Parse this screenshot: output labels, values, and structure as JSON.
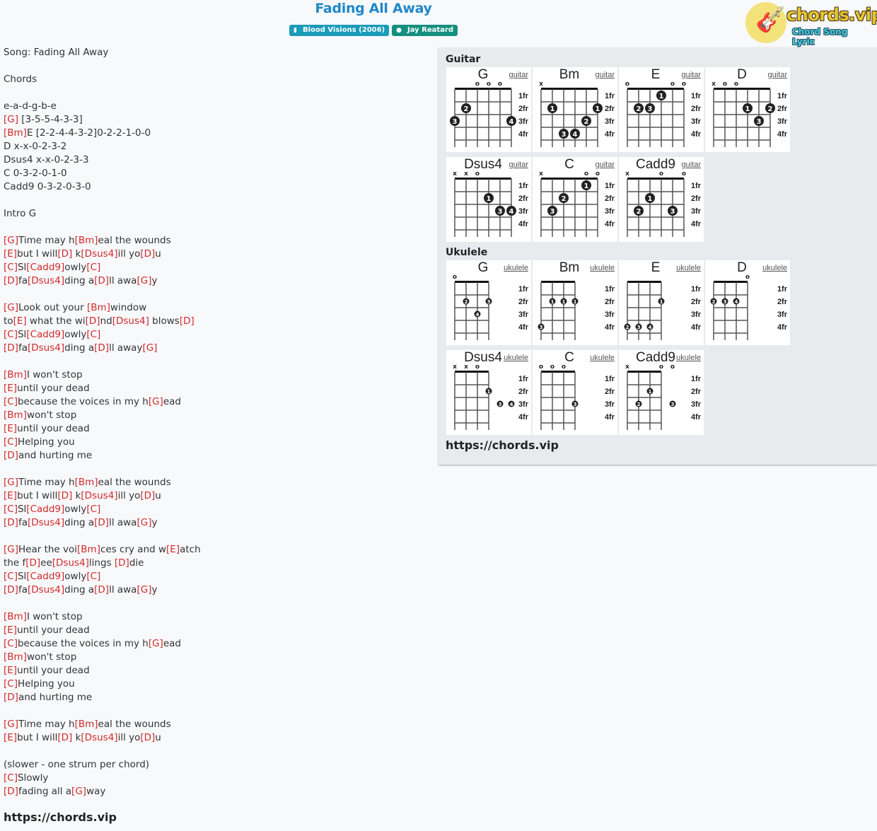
{
  "header": {
    "title": "Fading All Away",
    "album_badge": "Blood Visions (2006)",
    "album_icon": "book-icon",
    "artist_badge": "Jay Reatard",
    "artist_icon": "user-icon"
  },
  "logo": {
    "text": "chords.vip",
    "subtitle": "Chord Song Lyric",
    "icon": "guitar-icon"
  },
  "lyrics": [
    [
      {
        "t": "Song: Fading All Away"
      }
    ],
    [],
    [
      {
        "t": "Chords"
      }
    ],
    [],
    [
      {
        "t": "e-a-d-g-b-e"
      }
    ],
    [
      {
        "c": "[G]"
      },
      {
        "t": " [3-5-5-4-3-3]"
      }
    ],
    [
      {
        "c": "[Bm]"
      },
      {
        "t": "E [2-2-4-4-3-2]0-2-2-1-0-0"
      }
    ],
    [
      {
        "t": "D x-x-0-2-3-2"
      }
    ],
    [
      {
        "t": "Dsus4 x-x-0-2-3-3"
      }
    ],
    [
      {
        "t": "C 0-3-2-0-1-0"
      }
    ],
    [
      {
        "t": "Cadd9 0-3-2-0-3-0"
      }
    ],
    [],
    [
      {
        "t": "Intro G"
      }
    ],
    [],
    [
      {
        "c": "[G]"
      },
      {
        "t": "Time may h"
      },
      {
        "c": "[Bm]"
      },
      {
        "t": "eal the wounds"
      }
    ],
    [
      {
        "c": "[E]"
      },
      {
        "t": "but I will"
      },
      {
        "c": "[D]"
      },
      {
        "t": " k"
      },
      {
        "c": "[Dsus4]"
      },
      {
        "t": "ill yo"
      },
      {
        "c": "[D]"
      },
      {
        "t": "u"
      }
    ],
    [
      {
        "c": "[C]"
      },
      {
        "t": "Sl"
      },
      {
        "c": "[Cadd9]"
      },
      {
        "t": "owly"
      },
      {
        "c": "[C]"
      }
    ],
    [
      {
        "c": "[D]"
      },
      {
        "t": "fa"
      },
      {
        "c": "[Dsus4]"
      },
      {
        "t": "ding a"
      },
      {
        "c": "[D]"
      },
      {
        "t": "ll awa"
      },
      {
        "c": "[G]"
      },
      {
        "t": "y"
      }
    ],
    [],
    [
      {
        "c": "[G]"
      },
      {
        "t": "Look out your "
      },
      {
        "c": "[Bm]"
      },
      {
        "t": "window"
      }
    ],
    [
      {
        "t": "to"
      },
      {
        "c": "[E]"
      },
      {
        "t": " what the wi"
      },
      {
        "c": "[D]"
      },
      {
        "t": "nd"
      },
      {
        "c": "[Dsus4]"
      },
      {
        "t": " blows"
      },
      {
        "c": "[D]"
      }
    ],
    [
      {
        "c": "[C]"
      },
      {
        "t": "Sl"
      },
      {
        "c": "[Cadd9]"
      },
      {
        "t": "owly"
      },
      {
        "c": "[C]"
      }
    ],
    [
      {
        "c": "[D]"
      },
      {
        "t": "fa"
      },
      {
        "c": "[Dsus4]"
      },
      {
        "t": "ding a"
      },
      {
        "c": "[D]"
      },
      {
        "t": "ll away"
      },
      {
        "c": "[G]"
      }
    ],
    [],
    [
      {
        "c": "[Bm]"
      },
      {
        "t": "I won't stop"
      }
    ],
    [
      {
        "c": "[E]"
      },
      {
        "t": "until your dead"
      }
    ],
    [
      {
        "c": "[C]"
      },
      {
        "t": "because the voices in my h"
      },
      {
        "c": "[G]"
      },
      {
        "t": "ead"
      }
    ],
    [
      {
        "c": "[Bm]"
      },
      {
        "t": "won't stop"
      }
    ],
    [
      {
        "c": "[E]"
      },
      {
        "t": "until your dead"
      }
    ],
    [
      {
        "c": "[C]"
      },
      {
        "t": "Helping you"
      }
    ],
    [
      {
        "c": "[D]"
      },
      {
        "t": "and hurting me"
      }
    ],
    [],
    [
      {
        "c": "[G]"
      },
      {
        "t": "Time may h"
      },
      {
        "c": "[Bm]"
      },
      {
        "t": "eal the wounds"
      }
    ],
    [
      {
        "c": "[E]"
      },
      {
        "t": "but I will"
      },
      {
        "c": "[D]"
      },
      {
        "t": " k"
      },
      {
        "c": "[Dsus4]"
      },
      {
        "t": "ill yo"
      },
      {
        "c": "[D]"
      },
      {
        "t": "u"
      }
    ],
    [
      {
        "c": "[C]"
      },
      {
        "t": "Sl"
      },
      {
        "c": "[Cadd9]"
      },
      {
        "t": "owly"
      },
      {
        "c": "[C]"
      }
    ],
    [
      {
        "c": "[D]"
      },
      {
        "t": "fa"
      },
      {
        "c": "[Dsus4]"
      },
      {
        "t": "ding a"
      },
      {
        "c": "[D]"
      },
      {
        "t": "ll awa"
      },
      {
        "c": "[G]"
      },
      {
        "t": "y"
      }
    ],
    [],
    [
      {
        "c": "[G]"
      },
      {
        "t": "Hear the voi"
      },
      {
        "c": "[Bm]"
      },
      {
        "t": "ces cry and w"
      },
      {
        "c": "[E]"
      },
      {
        "t": "atch"
      }
    ],
    [
      {
        "t": "the f"
      },
      {
        "c": "[D]"
      },
      {
        "t": "ee"
      },
      {
        "c": "[Dsus4]"
      },
      {
        "t": "lings "
      },
      {
        "c": "[D]"
      },
      {
        "t": "die"
      }
    ],
    [
      {
        "c": "[C]"
      },
      {
        "t": "Sl"
      },
      {
        "c": "[Cadd9]"
      },
      {
        "t": "owly"
      },
      {
        "c": "[C]"
      }
    ],
    [
      {
        "c": "[D]"
      },
      {
        "t": "fa"
      },
      {
        "c": "[Dsus4]"
      },
      {
        "t": "ding a"
      },
      {
        "c": "[D]"
      },
      {
        "t": "ll awa"
      },
      {
        "c": "[G]"
      },
      {
        "t": "y"
      }
    ],
    [],
    [
      {
        "c": "[Bm]"
      },
      {
        "t": "I won't stop"
      }
    ],
    [
      {
        "c": "[E]"
      },
      {
        "t": "until your dead"
      }
    ],
    [
      {
        "c": "[C]"
      },
      {
        "t": "because the voices in my h"
      },
      {
        "c": "[G]"
      },
      {
        "t": "ead"
      }
    ],
    [
      {
        "c": "[Bm]"
      },
      {
        "t": "won't stop"
      }
    ],
    [
      {
        "c": "[E]"
      },
      {
        "t": "until your dead"
      }
    ],
    [
      {
        "c": "[C]"
      },
      {
        "t": "Helping you"
      }
    ],
    [
      {
        "c": "[D]"
      },
      {
        "t": "and hurting me"
      }
    ],
    [],
    [
      {
        "c": "[G]"
      },
      {
        "t": "Time may h"
      },
      {
        "c": "[Bm]"
      },
      {
        "t": "eal the wounds"
      }
    ],
    [
      {
        "c": "[E]"
      },
      {
        "t": "but I will"
      },
      {
        "c": "[D]"
      },
      {
        "t": " k"
      },
      {
        "c": "[Dsus4]"
      },
      {
        "t": "ill yo"
      },
      {
        "c": "[D]"
      },
      {
        "t": "u"
      }
    ],
    [],
    [
      {
        "t": "(slower - one strum per chord)"
      }
    ],
    [
      {
        "c": "[C]"
      },
      {
        "t": "Slowly"
      }
    ],
    [
      {
        "c": "[D]"
      },
      {
        "t": "fading all a"
      },
      {
        "c": "[G]"
      },
      {
        "t": "way"
      }
    ]
  ],
  "footer_link": "https://chords.vip",
  "chord_panel": {
    "guitar_title": "Guitar",
    "ukulele_title": "Ukulele",
    "link": "https://chords.vip",
    "fret_labels": [
      "1fr",
      "2fr",
      "3fr",
      "4fr"
    ],
    "guitar": [
      {
        "name": "G",
        "instrument": "guitar",
        "markers": [
          "",
          "",
          "o",
          "o",
          "o",
          ""
        ],
        "dots": [
          {
            "s": 1,
            "f": 3,
            "n": "3"
          },
          {
            "s": 2,
            "f": 2,
            "n": "2"
          },
          {
            "s": 6,
            "f": 3,
            "n": "4"
          }
        ]
      },
      {
        "name": "Bm",
        "instrument": "guitar",
        "markers": [
          "x",
          "",
          "",
          "",
          "",
          ""
        ],
        "dots": [
          {
            "s": 2,
            "f": 2,
            "n": "1"
          },
          {
            "s": 6,
            "f": 2,
            "n": "1"
          },
          {
            "s": 5,
            "f": 3,
            "n": "2"
          },
          {
            "s": 3,
            "f": 4,
            "n": "3"
          },
          {
            "s": 4,
            "f": 4,
            "n": "4"
          }
        ]
      },
      {
        "name": "E",
        "instrument": "guitar",
        "markers": [
          "o",
          "",
          "",
          "",
          "o",
          "o"
        ],
        "dots": [
          {
            "s": 4,
            "f": 1,
            "n": "1"
          },
          {
            "s": 2,
            "f": 2,
            "n": "2"
          },
          {
            "s": 3,
            "f": 2,
            "n": "3"
          }
        ]
      },
      {
        "name": "D",
        "instrument": "guitar",
        "markers": [
          "x",
          "o",
          "o",
          "",
          "",
          ""
        ],
        "dots": [
          {
            "s": 4,
            "f": 2,
            "n": "1"
          },
          {
            "s": 6,
            "f": 2,
            "n": "2"
          },
          {
            "s": 5,
            "f": 3,
            "n": "3"
          }
        ]
      },
      {
        "name": "Dsus4",
        "instrument": "guitar",
        "markers": [
          "x",
          "x",
          "o",
          "",
          "",
          ""
        ],
        "dots": [
          {
            "s": 4,
            "f": 2,
            "n": "1"
          },
          {
            "s": 5,
            "f": 3,
            "n": "3"
          },
          {
            "s": 6,
            "f": 3,
            "n": "4"
          }
        ]
      },
      {
        "name": "C",
        "instrument": "guitar",
        "markers": [
          "x",
          "",
          "",
          "",
          "o",
          "o"
        ],
        "dots": [
          {
            "s": 5,
            "f": 1,
            "n": "1"
          },
          {
            "s": 3,
            "f": 2,
            "n": "2"
          },
          {
            "s": 2,
            "f": 3,
            "n": "3"
          }
        ]
      },
      {
        "name": "Cadd9",
        "instrument": "guitar",
        "markers": [
          "x",
          "",
          "",
          "o",
          "",
          "o"
        ],
        "dots": [
          {
            "s": 3,
            "f": 2,
            "n": "1"
          },
          {
            "s": 2,
            "f": 3,
            "n": "2"
          },
          {
            "s": 5,
            "f": 3,
            "n": "3"
          }
        ]
      }
    ],
    "ukulele": [
      {
        "name": "G",
        "instrument": "ukulele",
        "markers": [
          "o",
          "",
          "",
          ""
        ],
        "dots": [
          {
            "s": 2,
            "f": 2,
            "n": "2"
          },
          {
            "s": 4,
            "f": 2,
            "n": "3"
          },
          {
            "s": 3,
            "f": 3,
            "n": "4"
          }
        ]
      },
      {
        "name": "Bm",
        "instrument": "ukulele",
        "markers": [
          "",
          "",
          "",
          ""
        ],
        "dots": [
          {
            "s": 2,
            "f": 2,
            "n": "1"
          },
          {
            "s": 3,
            "f": 2,
            "n": "1"
          },
          {
            "s": 4,
            "f": 2,
            "n": "1"
          },
          {
            "s": 1,
            "f": 4,
            "n": "3"
          }
        ]
      },
      {
        "name": "E",
        "instrument": "ukulele",
        "markers": [
          "",
          "",
          "",
          ""
        ],
        "dots": [
          {
            "s": 4,
            "f": 2,
            "n": "1"
          },
          {
            "s": 1,
            "f": 4,
            "n": "2"
          },
          {
            "s": 2,
            "f": 4,
            "n": "3"
          },
          {
            "s": 3,
            "f": 4,
            "n": "4"
          }
        ]
      },
      {
        "name": "D",
        "instrument": "ukulele",
        "markers": [
          "",
          "",
          "",
          "o"
        ],
        "dots": [
          {
            "s": 1,
            "f": 2,
            "n": "2"
          },
          {
            "s": 2,
            "f": 2,
            "n": "3"
          },
          {
            "s": 3,
            "f": 2,
            "n": "4"
          }
        ]
      },
      {
        "name": "Dsus4",
        "instrument": "ukulele",
        "markers": [
          "x",
          "x",
          "o",
          ""
        ],
        "dots": [
          {
            "s": 4,
            "f": 2,
            "n": "1"
          },
          {
            "s": 5,
            "f": 3,
            "n": "3"
          },
          {
            "s": 6,
            "f": 3,
            "n": "4"
          }
        ]
      },
      {
        "name": "C",
        "instrument": "ukulele",
        "markers": [
          "o",
          "o",
          "o",
          ""
        ],
        "dots": [
          {
            "s": 4,
            "f": 3,
            "n": "3"
          }
        ]
      },
      {
        "name": "Cadd9",
        "instrument": "ukulele",
        "markers": [
          "x",
          "",
          "",
          "o"
        ],
        "extra_markers": [
          {
            "s": 5,
            "m": "o"
          }
        ],
        "dots": [
          {
            "s": 3,
            "f": 2,
            "n": "1"
          },
          {
            "s": 2,
            "f": 3,
            "n": "2"
          },
          {
            "s": 5,
            "f": 3,
            "n": "3"
          }
        ]
      }
    ]
  }
}
